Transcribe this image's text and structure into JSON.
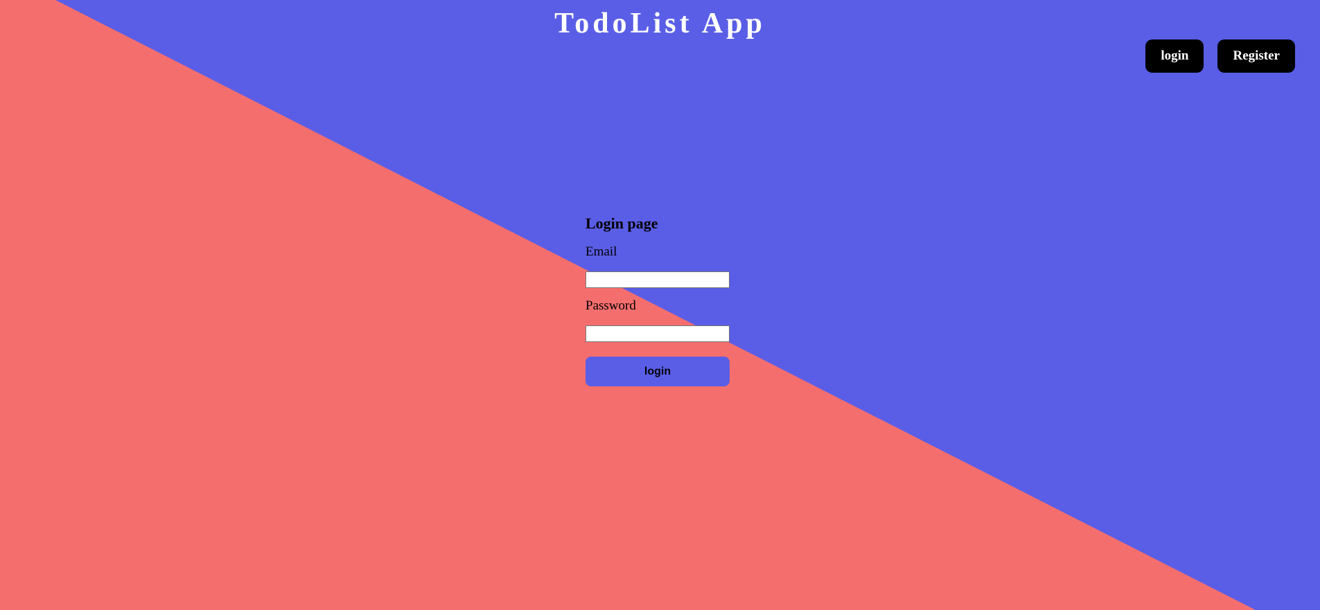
{
  "colors": {
    "blue": "#5a5ee6",
    "coral": "#f56e6e",
    "nav_button_bg": "#000000",
    "title_text": "#ffffff"
  },
  "header": {
    "title": "TodoList App"
  },
  "nav": {
    "login_label": "login",
    "register_label": "Register"
  },
  "form": {
    "heading": "Login page",
    "email_label": "Email",
    "email_value": "",
    "password_label": "Password",
    "password_value": "",
    "submit_label": "login"
  }
}
